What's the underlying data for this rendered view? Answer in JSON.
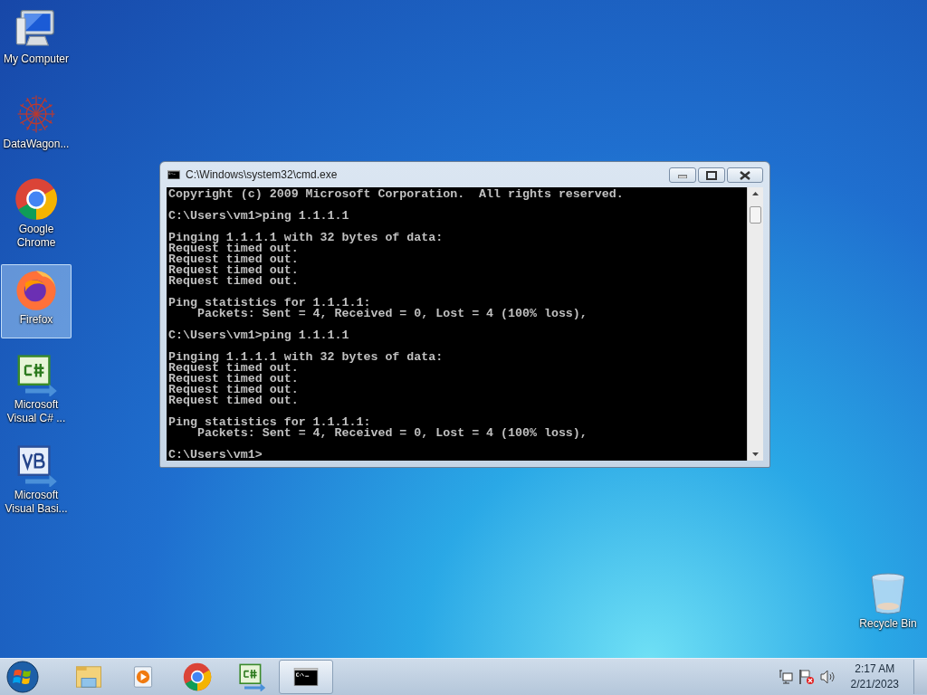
{
  "desktop_icons": [
    {
      "label": "My Computer",
      "kind": "computer",
      "selected": false
    },
    {
      "label": "DataWagon...",
      "kind": "datawagon",
      "selected": false
    },
    {
      "label": "Google Chrome",
      "kind": "chrome",
      "selected": false
    },
    {
      "label": "Firefox",
      "kind": "firefox",
      "selected": true
    },
    {
      "label": "Microsoft Visual C# ...",
      "kind": "csharp",
      "selected": false
    },
    {
      "label": "Microsoft Visual Basi...",
      "kind": "vb",
      "selected": false
    }
  ],
  "recycle_bin": {
    "label": "Recycle Bin"
  },
  "window": {
    "title": "C:\\Windows\\system32\\cmd.exe",
    "console_blocks": [
      [
        "Copyright (c) 2009 Microsoft Corporation.  All rights reserved."
      ],
      [
        "C:\\Users\\vm1>ping 1.1.1.1"
      ],
      [
        "Pinging 1.1.1.1 with 32 bytes of data:",
        "Request timed out.",
        "Request timed out.",
        "Request timed out.",
        "Request timed out."
      ],
      [
        "Ping statistics for 1.1.1.1:",
        "    Packets: Sent = 4, Received = 0, Lost = 4 (100% loss),"
      ],
      [
        "C:\\Users\\vm1>ping 1.1.1.1"
      ],
      [
        "Pinging 1.1.1.1 with 32 bytes of data:",
        "Request timed out.",
        "Request timed out.",
        "Request timed out.",
        "Request timed out."
      ],
      [
        "Ping statistics for 1.1.1.1:",
        "    Packets: Sent = 4, Received = 0, Lost = 4 (100% loss),"
      ],
      [
        "C:\\Users\\vm1>"
      ]
    ]
  },
  "taskbar": {
    "items": [
      {
        "kind": "explorer",
        "selected": false
      },
      {
        "kind": "media",
        "selected": false
      },
      {
        "kind": "chrome",
        "selected": false
      },
      {
        "kind": "csharp",
        "selected": false
      },
      {
        "kind": "cmd",
        "selected": true
      }
    ],
    "time": "2:17 AM",
    "date": "2/21/2023"
  }
}
